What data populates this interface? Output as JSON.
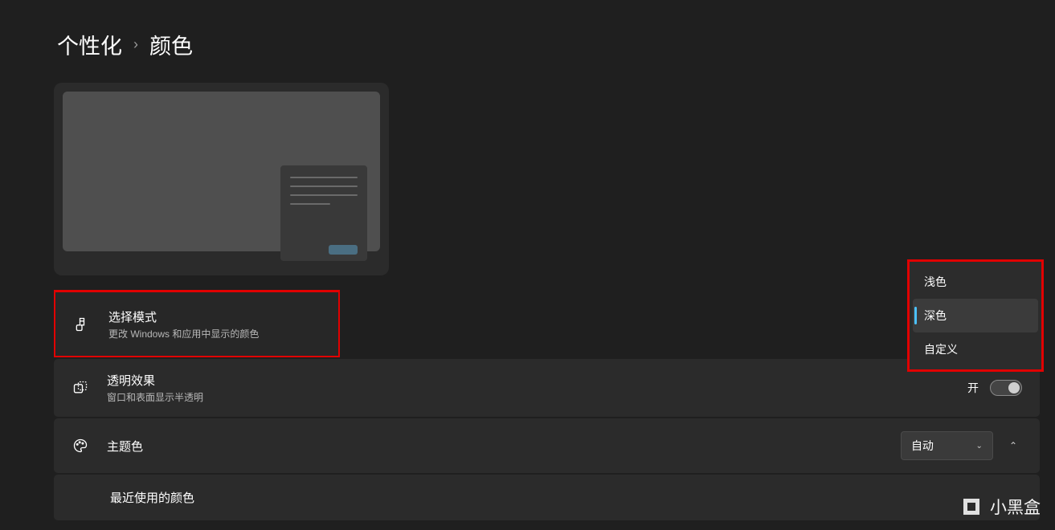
{
  "breadcrumb": {
    "parent": "个性化",
    "separator": "›",
    "current": "颜色"
  },
  "settings": {
    "mode": {
      "title": "选择模式",
      "desc": "更改 Windows 和应用中显示的颜色"
    },
    "transparency": {
      "title": "透明效果",
      "desc": "窗口和表面显示半透明",
      "toggle_label": "开"
    },
    "accent": {
      "title": "主题色",
      "dropdown_value": "自动"
    },
    "recent": {
      "title": "最近使用的颜色"
    }
  },
  "mode_options": {
    "light": "浅色",
    "dark": "深色",
    "custom": "自定义"
  },
  "watermark": {
    "text": "小黑盒"
  }
}
